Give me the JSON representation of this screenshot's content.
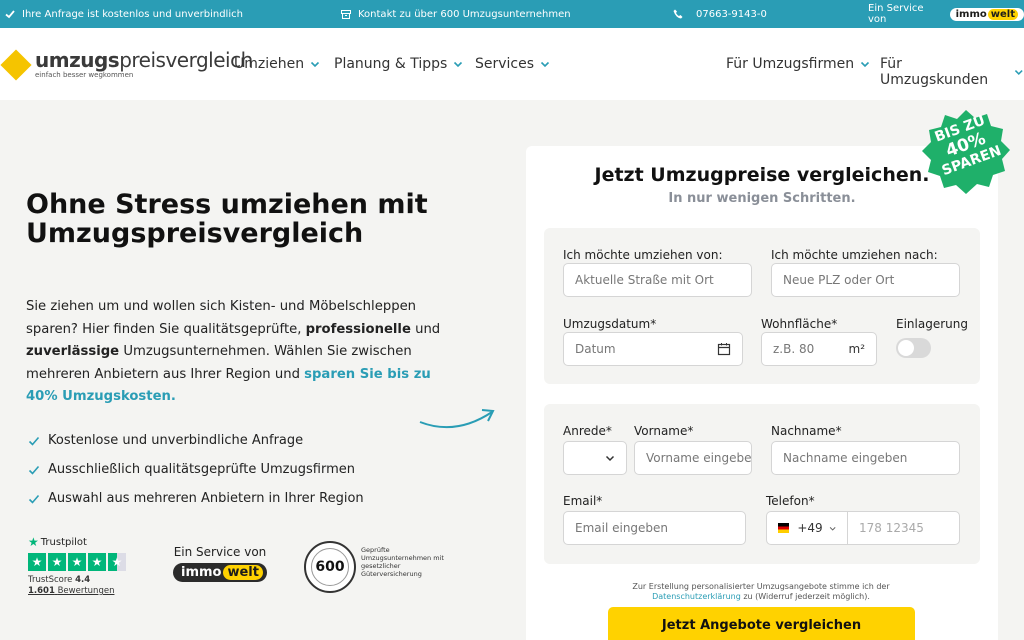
{
  "topbar": {
    "info": "Ihre Anfrage ist kostenlos und unverbindlich",
    "contact": "Kontakt zu über 600 Umzugsunternehmen",
    "phone": "07663-9143-0",
    "service_prefix": "Ein Service von",
    "immo_a": "immo",
    "immo_b": "welt"
  },
  "logo": {
    "part1": "umzugs",
    "part2": "preisvergleich",
    "tagline": "einfach besser wegkommen"
  },
  "nav": {
    "items": [
      {
        "label": "Umziehen"
      },
      {
        "label": "Planung & Tipps"
      },
      {
        "label": "Services"
      },
      {
        "label": "Für Umzugsfirmen"
      },
      {
        "label": "Für Umzugskunden"
      }
    ]
  },
  "hero": {
    "title": "Ohne Stress umziehen mit Umzugspreisvergleich",
    "text_1": "Sie ziehen um und wollen sich Kisten- und Möbelschleppen sparen? Hier finden Sie qualitätsgeprüfte, ",
    "text_b1": "professionelle",
    "text_2": " und ",
    "text_b2": "zuverlässige",
    "text_3": " Umzugsunternehmen. Wählen Sie zwischen mehreren Anbietern aus Ihrer Region und ",
    "text_accent": "sparen Sie bis zu 40% Umzugskosten.",
    "checks": [
      "Kostenlose und unverbindliche Anfrage",
      "Ausschließlich qualitätsgeprüfte Umzugsfirmen",
      "Auswahl aus mehreren Anbietern in Ihrer Region"
    ]
  },
  "trust": {
    "trustpilot": "Trustpilot",
    "score_label": "TrustScore",
    "score": "4.4",
    "reviews_count": "1.601",
    "reviews_label": "Bewertungen",
    "rating_stars": 4.5,
    "service_label": "Ein Service von",
    "immo_a": "immo",
    "immo_b": "welt",
    "seal_number": "600",
    "seal_text": "Geprüfte Umzugsunternehmen mit gesetzlicher Güterversicherung"
  },
  "promo": {
    "line1": "BIS ZU",
    "line2": "40%",
    "line3": "SPAREN",
    "color": "#1fb06a"
  },
  "form": {
    "title": "Jetzt Umzugpreise vergleichen.",
    "subtitle": "In nur wenigen Schritten.",
    "from_label": "Ich möchte umziehen von:",
    "from_placeholder": "Aktuelle Straße mit Ort",
    "to_label": "Ich möchte umziehen nach:",
    "to_placeholder": "Neue PLZ oder Ort",
    "date_label": "Umzugsdatum*",
    "date_placeholder": "Datum",
    "area_label": "Wohnfläche*",
    "area_placeholder": "z.B. 80",
    "area_unit": "m²",
    "storage_label": "Einlagerung",
    "salutation_label": "Anrede*",
    "firstname_label": "Vorname*",
    "firstname_placeholder": "Vorname eingeben",
    "lastname_label": "Nachname*",
    "lastname_placeholder": "Nachname eingeben",
    "email_label": "Email*",
    "email_placeholder": "Email eingeben",
    "phone_label": "Telefon*",
    "phone_prefix": "+49",
    "phone_placeholder": "178 12345",
    "consent_1": "Zur Erstellung personalisierter Umzugsangebote stimme ich der ",
    "consent_link": "Datenschutzerklärung",
    "consent_2": " zu (Widerruf jederzeit möglich).",
    "submit": "Jetzt Angebote vergleichen"
  },
  "colors": {
    "accent": "#2a9db5",
    "brand_yellow": "#ffd200",
    "trustpilot_green": "#00b67a"
  }
}
